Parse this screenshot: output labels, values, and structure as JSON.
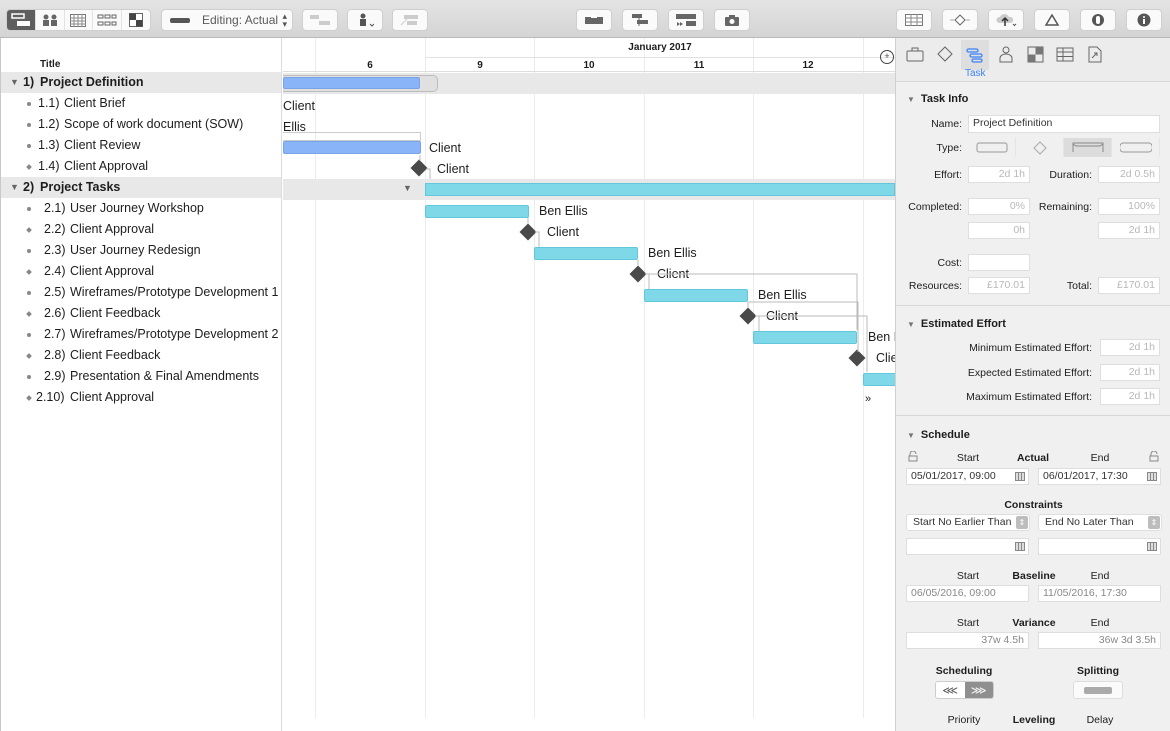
{
  "toolbar": {
    "view_modes": [
      "gantt-view",
      "resource-view",
      "calendar-view",
      "network-view",
      "styles-view"
    ],
    "editing_label": "Editing: Actual",
    "buttons_left": [
      "connect-tasks",
      "assign-resource",
      "split-task"
    ],
    "buttons_center": [
      "baseline",
      "group",
      "catch-up",
      "snapshot"
    ],
    "buttons_right": [
      "table",
      "milestone-view",
      "share",
      "variance",
      "focus",
      "info"
    ]
  },
  "outline": {
    "header": "Title",
    "rows": [
      {
        "num": "1)",
        "title": "Project Definition",
        "group": true
      },
      {
        "num": "1.1)",
        "title": "Client Brief"
      },
      {
        "num": "1.2)",
        "title": "Scope of work document (SOW)"
      },
      {
        "num": "1.3)",
        "title": "Client Review"
      },
      {
        "num": "1.4)",
        "title": "Client Approval",
        "milestone": true
      },
      {
        "num": "2)",
        "title": "Project Tasks",
        "group": true
      },
      {
        "num": "2.1)",
        "title": "User Journey Workshop"
      },
      {
        "num": "2.2)",
        "title": "Client Approval",
        "milestone": true
      },
      {
        "num": "2.3)",
        "title": "User Journey Redesign"
      },
      {
        "num": "2.4)",
        "title": "Client Approval",
        "milestone": true
      },
      {
        "num": "2.5)",
        "title": "Wireframes/Prototype Development 1"
      },
      {
        "num": "2.6)",
        "title": "Client Feedback",
        "milestone": true
      },
      {
        "num": "2.7)",
        "title": "Wireframes/Prototype Development 2"
      },
      {
        "num": "2.8)",
        "title": "Client Feedback",
        "milestone": true
      },
      {
        "num": "2.9)",
        "title": "Presentation & Final Amendments"
      },
      {
        "num": "2.10)",
        "title": "Client Approval",
        "milestone": true
      }
    ]
  },
  "gantt": {
    "month": "January 2017",
    "days": [
      "6",
      "9",
      "10",
      "11",
      "12"
    ],
    "labels": {
      "r1": "Client",
      "r2": "Ellis",
      "r3": "Client",
      "r4": "Client",
      "r6": "Ben Ellis",
      "r7": "Client",
      "r8": "Ben Ellis",
      "r9": "Client",
      "r10": "Ben Ellis",
      "r11": "Client",
      "r12": "Ben E",
      "r13": "Clie",
      "more": "»"
    }
  },
  "inspector": {
    "tabs": [
      "project",
      "milestone",
      "task",
      "resource",
      "styles",
      "table",
      "export"
    ],
    "active_tab_label": "Task",
    "task_info": {
      "title": "Task Info",
      "name_label": "Name:",
      "name_value": "Project Definition",
      "type_label": "Type:",
      "effort_label": "Effort:",
      "effort_value": "2d 1h",
      "duration_label": "Duration:",
      "duration_value": "2d 0.5h",
      "completed_label": "Completed:",
      "completed_pct": "0%",
      "completed_time": "0h",
      "remaining_label": "Remaining:",
      "remaining_pct": "100%",
      "remaining_time": "2d 1h",
      "cost_label": "Cost:",
      "cost_value": "",
      "resources_label": "Resources:",
      "resources_value": "£170.01",
      "total_label": "Total:",
      "total_value": "£170.01"
    },
    "estimated_effort": {
      "title": "Estimated Effort",
      "min_label": "Minimum Estimated Effort:",
      "min_value": "2d 1h",
      "exp_label": "Expected Estimated Effort:",
      "exp_value": "2d 1h",
      "max_label": "Maximum Estimated Effort:",
      "max_value": "2d 1h"
    },
    "schedule": {
      "title": "Schedule",
      "start": "Start",
      "end": "End",
      "actual": "Actual",
      "actual_start": "05/01/2017, 09:00",
      "actual_end": "06/01/2017, 17:30",
      "constraints": "Constraints",
      "constraint_start": "Start No Earlier Than",
      "constraint_end": "End No Later Than",
      "baseline": "Baseline",
      "baseline_start": "06/05/2016, 09:00",
      "baseline_end": "11/05/2016, 17:30",
      "variance": "Variance",
      "variance_start": "37w 4.5h",
      "variance_end": "36w 3d 3.5h",
      "scheduling": "Scheduling",
      "splitting": "Splitting",
      "sched_back": "«‹",
      "sched_fwd": "›»",
      "priority": "Priority",
      "leveling": "Leveling",
      "delay": "Delay"
    }
  }
}
